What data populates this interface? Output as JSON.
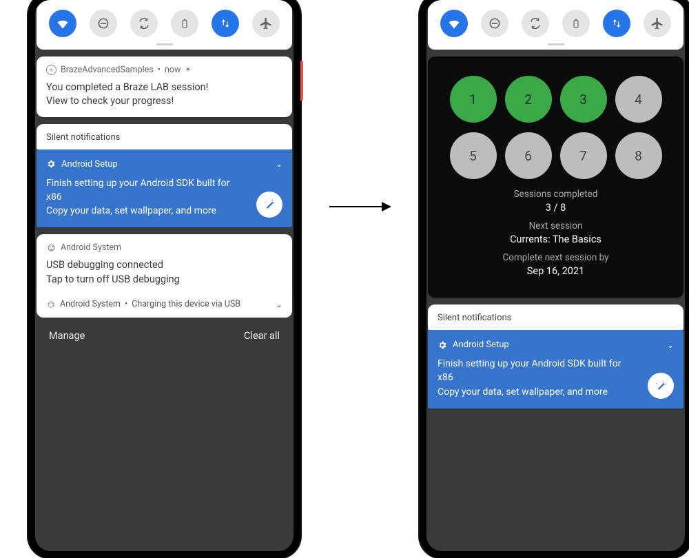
{
  "qs_icons": [
    "wifi",
    "dnd",
    "sync",
    "battery",
    "data",
    "airplane"
  ],
  "notif1": {
    "app": "BrazeAdvancedSamples",
    "time": "now",
    "line1": "You completed a Braze LAB session!",
    "line2": "View to check your progress!"
  },
  "silent_header": "Silent notifications",
  "setup": {
    "app": "Android Setup",
    "line1": "Finish setting up your Android SDK built for x86",
    "line2": "Copy your data, set wallpaper, and more"
  },
  "usb": {
    "app": "Android System",
    "line1": "USB debugging connected",
    "line2": "Tap to turn off USB debugging"
  },
  "charging": {
    "app": "Android System",
    "text": "Charging this device via USB"
  },
  "footer": {
    "manage": "Manage",
    "clear": "Clear all"
  },
  "progress": {
    "bubbles": [
      {
        "n": "1",
        "done": true
      },
      {
        "n": "2",
        "done": true
      },
      {
        "n": "3",
        "done": true
      },
      {
        "n": "4",
        "done": false
      },
      {
        "n": "5",
        "done": false
      },
      {
        "n": "6",
        "done": false
      },
      {
        "n": "7",
        "done": false
      },
      {
        "n": "8",
        "done": false
      }
    ],
    "sessions_label": "Sessions completed",
    "sessions_value": "3 / 8",
    "next_label": "Next session",
    "next_value": "Currents: The Basics",
    "due_label": "Complete next session by",
    "due_value": "Sep 16, 2021"
  }
}
